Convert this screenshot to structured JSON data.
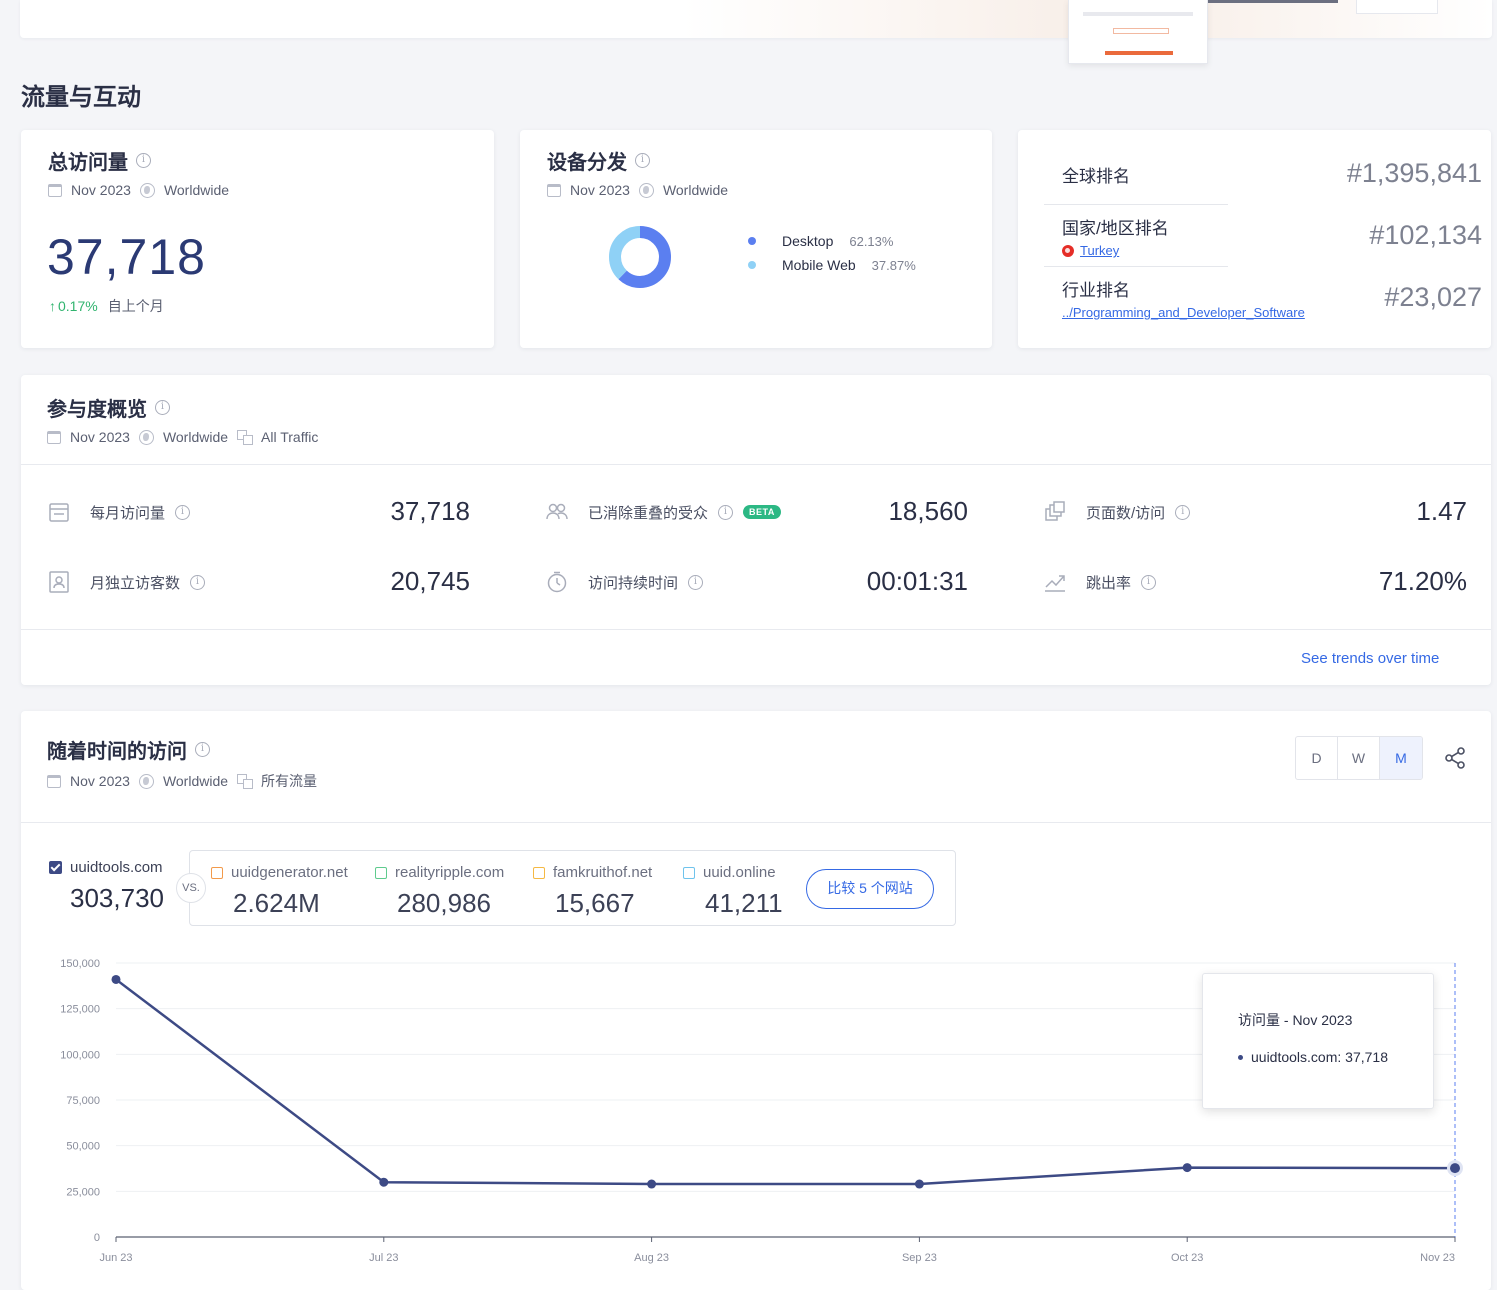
{
  "section_title": "流量与互动",
  "total_visits": {
    "title": "总访问量",
    "date": "Nov 2023",
    "region": "Worldwide",
    "value": "37,718",
    "change": "0.17%",
    "change_label": "自上个月"
  },
  "device": {
    "title": "设备分发",
    "date": "Nov 2023",
    "region": "Worldwide",
    "items": [
      {
        "label": "Desktop",
        "pct": "62.13%",
        "value": 62.13,
        "color": "#5b7ff0"
      },
      {
        "label": "Mobile Web",
        "pct": "37.87%",
        "value": 37.87,
        "color": "#8fd1f6"
      }
    ]
  },
  "ranks": {
    "global_label": "全球排名",
    "global_value": "#1,395,841",
    "country_label": "国家/地区排名",
    "country_name": "Turkey",
    "country_value": "#102,134",
    "industry_label": "行业排名",
    "industry_name": "../Programming_and_Developer_Software",
    "industry_value": "#23,027"
  },
  "engagement": {
    "title": "参与度概览",
    "date": "Nov 2023",
    "region": "Worldwide",
    "traffic": "All Traffic",
    "metrics": [
      {
        "label": "每月访问量",
        "value": "37,718",
        "icon": "calendar-icon"
      },
      {
        "label": "已消除重叠的受众",
        "value": "18,560",
        "icon": "users-icon",
        "badge": "BETA"
      },
      {
        "label": "页面数/访问",
        "value": "1.47",
        "icon": "pages-icon"
      },
      {
        "label": "月独立访客数",
        "value": "20,745",
        "icon": "visitor-id-icon"
      },
      {
        "label": "访问持续时间",
        "value": "00:01:31",
        "icon": "clock-icon"
      },
      {
        "label": "跳出率",
        "value": "71.20%",
        "icon": "bounce-icon"
      }
    ],
    "trends_link": "See trends over time"
  },
  "visits_over_time": {
    "title": "随着时间的访问",
    "date": "Nov 2023",
    "region": "Worldwide",
    "traffic": "所有流量",
    "granularity": [
      "D",
      "W",
      "M"
    ],
    "active_granularity": "M",
    "main_site": {
      "name": "uuidtools.com",
      "value": "303,730"
    },
    "vs_label": "VS.",
    "competitors": [
      {
        "name": "uuidgenerator.net",
        "value": "2.624M",
        "color": "#f29a4b"
      },
      {
        "name": "realityripple.com",
        "value": "280,986",
        "color": "#5fcb8e"
      },
      {
        "name": "famkruithof.net",
        "value": "15,667",
        "color": "#f5b944"
      },
      {
        "name": "uuid.online",
        "value": "41,211",
        "color": "#6fc3ec"
      }
    ],
    "compare_button": "比较 5 个网站",
    "tooltip_title": "访问量 - Nov 2023",
    "tooltip_row": "uuidtools.com: 37,718"
  },
  "chart_data": {
    "type": "line",
    "x": [
      "Jun 23",
      "Jul 23",
      "Aug 23",
      "Sep 23",
      "Oct 23",
      "Nov 23"
    ],
    "series": [
      {
        "name": "uuidtools.com",
        "values": [
          141000,
          30000,
          29000,
          29000,
          38000,
          37718
        ]
      }
    ],
    "ylim": [
      0,
      150000
    ],
    "yticks": [
      0,
      25000,
      50000,
      75000,
      100000,
      125000,
      150000
    ],
    "ytick_labels": [
      "0",
      "25,000",
      "50,000",
      "75,000",
      "100,000",
      "125,000",
      "150,000"
    ],
    "grid": true,
    "color": "#3d4a85"
  }
}
